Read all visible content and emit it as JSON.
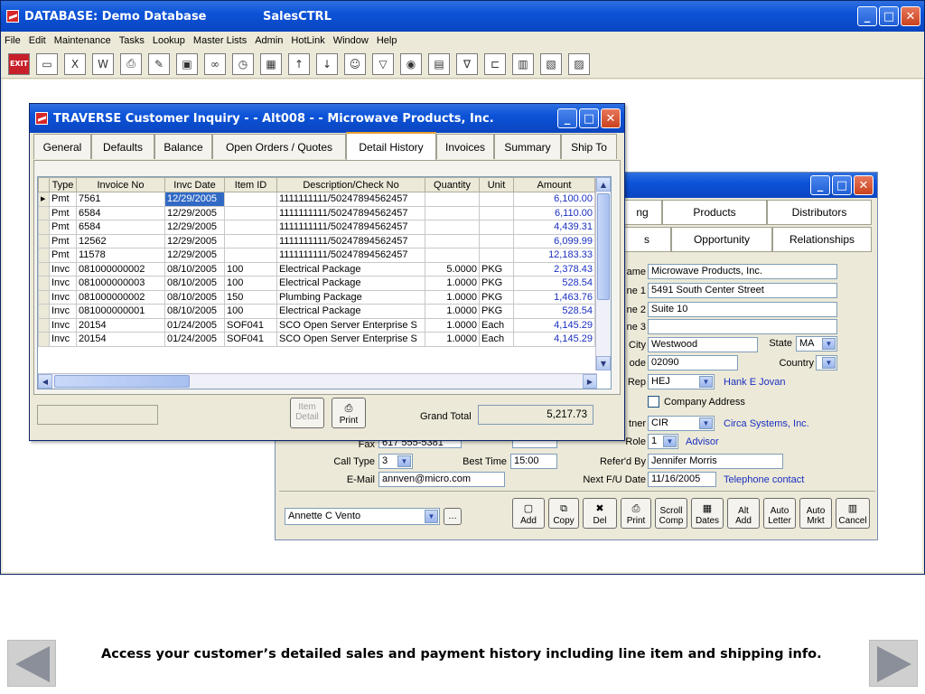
{
  "app": {
    "title": "DATABASE:  Demo Database",
    "subtitle": "SalesCTRL",
    "menu": [
      "File",
      "Edit",
      "Maintenance",
      "Tasks",
      "Lookup",
      "Master Lists",
      "Admin",
      "HotLink",
      "Window",
      "Help"
    ],
    "toolbar": [
      {
        "name": "exit",
        "glyph": "EXIT"
      },
      {
        "name": "folder-icon",
        "glyph": "▭"
      },
      {
        "name": "excel-icon",
        "glyph": "X"
      },
      {
        "name": "word-icon",
        "glyph": "W"
      },
      {
        "name": "printer-icon",
        "glyph": "⎙"
      },
      {
        "name": "notepad-icon",
        "glyph": "✎"
      },
      {
        "name": "window-icon",
        "glyph": "▣"
      },
      {
        "name": "binoculars-icon",
        "glyph": "∞"
      },
      {
        "name": "clock-icon",
        "glyph": "◷"
      },
      {
        "name": "calendar-icon",
        "glyph": "▦"
      },
      {
        "name": "arrow-up-icon",
        "glyph": "↑"
      },
      {
        "name": "arrow-down-icon",
        "glyph": "↓"
      },
      {
        "name": "person-icon",
        "glyph": "☺"
      },
      {
        "name": "filter-icon",
        "glyph": "▽"
      },
      {
        "name": "globe-icon",
        "glyph": "◉"
      },
      {
        "name": "report-icon",
        "glyph": "▤"
      },
      {
        "name": "funnel-icon",
        "glyph": "∇"
      },
      {
        "name": "flow-icon",
        "glyph": "⊏"
      },
      {
        "name": "book-icon",
        "glyph": "▥"
      },
      {
        "name": "ledger-icon",
        "glyph": "▧"
      },
      {
        "name": "clipboard-icon",
        "glyph": "▨"
      }
    ]
  },
  "customer": {
    "tabs_row1": [
      "ng",
      "Products",
      "Distributors"
    ],
    "tabs_row2": [
      "s",
      "Opportunity",
      "Relationships"
    ],
    "fields": {
      "name_label": "ame",
      "name": "Microwave Products, Inc.",
      "addr1_label": "ne 1",
      "addr1": "5491 South Center Street",
      "addr2_label": "ne 2",
      "addr2": "Suite 10",
      "addr3_label": "ne 3",
      "addr3": "",
      "city_label": "City",
      "city": "Westwood",
      "state_label": "State",
      "state": "MA",
      "zip_label": "ode",
      "zip": "02090",
      "country_label": "Country",
      "country": "",
      "rep_label": "Rep",
      "rep": "HEJ",
      "rep_name": "Hank E Jovan",
      "company_address": "Company Address",
      "partner_label": "tner",
      "partner": "CIR",
      "partner_name": "Circa Systems, Inc.",
      "role_label": "Role",
      "role": "1",
      "role_name": "Advisor",
      "fax_label": "Fax",
      "fax": "617  555-5381",
      "calltype_label": "Call Type",
      "calltype": "3",
      "besttime_label": "Best Time",
      "besttime": "15:00",
      "referred_label": "Refer'd By",
      "referred": "Jennifer Morris",
      "email_label": "E-Mail",
      "email": "annven@micro.com",
      "nextfu_label": "Next F/U Date",
      "nextfu": "11/16/2005",
      "nextfu_note": "Telephone contact",
      "contact": "Annette C Vento"
    },
    "buttons": [
      {
        "key": "add",
        "line1": "Add",
        "line2": "",
        "glyph": "▢"
      },
      {
        "key": "copy",
        "line1": "Copy",
        "line2": "",
        "glyph": "⧉"
      },
      {
        "key": "del",
        "line1": "Del",
        "line2": "",
        "glyph": "✖"
      },
      {
        "key": "print",
        "line1": "Print",
        "line2": "",
        "glyph": "⎙"
      },
      {
        "key": "scroll-comp",
        "line1": "Scroll",
        "line2": "Comp",
        "glyph": ""
      },
      {
        "key": "dates",
        "line1": "Dates",
        "line2": "",
        "glyph": "▦"
      },
      {
        "key": "alt-add",
        "line1": "Alt",
        "line2": "Add",
        "glyph": ""
      },
      {
        "key": "auto-letter",
        "line1": "Auto",
        "line2": "Letter",
        "glyph": ""
      },
      {
        "key": "auto-mrkt",
        "line1": "Auto",
        "line2": "Mrkt",
        "glyph": ""
      },
      {
        "key": "cancel",
        "line1": "Cancel",
        "line2": "",
        "glyph": "▥"
      }
    ]
  },
  "inquiry": {
    "title": "TRAVERSE Customer Inquiry - - Alt008     - - Microwave Products, Inc.",
    "tabs": [
      "General",
      "Defaults",
      "Balance",
      "Open Orders / Quotes",
      "Detail History",
      "Invoices",
      "Summary",
      "Ship To"
    ],
    "active_tab": "Detail History",
    "columns": [
      "Type",
      "Invoice No",
      "Invc Date",
      "Item ID",
      "Description/Check No",
      "Quantity",
      "Unit",
      "Amount"
    ],
    "rows": [
      [
        "Pmt",
        "7561",
        "12/29/2005",
        "",
        "1111111111/50247894562457",
        "",
        "",
        "6,100.00"
      ],
      [
        "Pmt",
        "6584",
        "12/29/2005",
        "",
        "1111111111/50247894562457",
        "",
        "",
        "6,110.00"
      ],
      [
        "Pmt",
        "6584",
        "12/29/2005",
        "",
        "1111111111/50247894562457",
        "",
        "",
        "4,439.31"
      ],
      [
        "Pmt",
        "12562",
        "12/29/2005",
        "",
        "1111111111/50247894562457",
        "",
        "",
        "6,099.99"
      ],
      [
        "Pmt",
        "11578",
        "12/29/2005",
        "",
        "1111111111/50247894562457",
        "",
        "",
        "12,183.33"
      ],
      [
        "Invc",
        "081000000002",
        "08/10/2005",
        "100",
        "Electrical Package",
        "5.0000",
        "PKG",
        "2,378.43"
      ],
      [
        "Invc",
        "081000000003",
        "08/10/2005",
        "100",
        "Electrical Package",
        "1.0000",
        "PKG",
        "528.54"
      ],
      [
        "Invc",
        "081000000002",
        "08/10/2005",
        "150",
        "Plumbing Package",
        "1.0000",
        "PKG",
        "1,463.76"
      ],
      [
        "Invc",
        "081000000001",
        "08/10/2005",
        "100",
        "Electrical Package",
        "1.0000",
        "PKG",
        "528.54"
      ],
      [
        "Invc",
        "20154",
        "01/24/2005",
        "SOF041",
        "SCO Open Server Enterprise S",
        "1.0000",
        "Each",
        "4,145.29"
      ],
      [
        "Invc",
        "20154",
        "01/24/2005",
        "SOF041",
        "SCO Open Server Enterprise S",
        "1.0000",
        "Each",
        "4,145.29"
      ]
    ],
    "item_detail": "Item Detail",
    "print": "Print",
    "grand_total_label": "Grand Total",
    "grand_total": "5,217.73"
  },
  "footer": {
    "caption": "Access your customer’s detailed sales and payment history including line item and shipping info."
  },
  "colors": {
    "title_blue": "#0c53d8",
    "link_blue": "#1a2fc0",
    "selection": "#316ac5"
  }
}
